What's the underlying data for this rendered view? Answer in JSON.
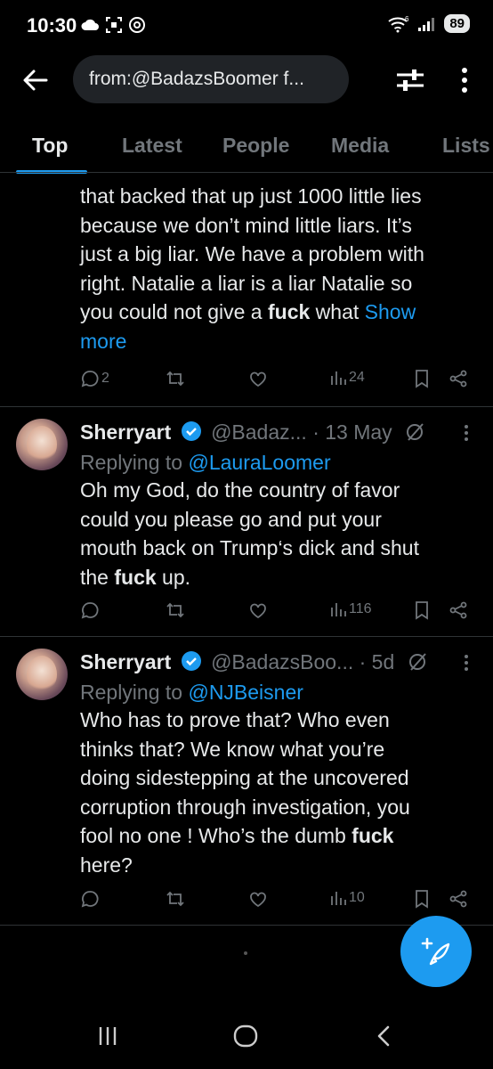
{
  "status": {
    "time": "10:30",
    "battery": "89",
    "network": "6"
  },
  "search": {
    "query": "from:@BadazsBoomer f..."
  },
  "tabs": [
    {
      "label": "Top"
    },
    {
      "label": "Latest"
    },
    {
      "label": "People"
    },
    {
      "label": "Media"
    },
    {
      "label": "Lists"
    }
  ],
  "tweets": [
    {
      "body_lines": [
        "that backed that up just 1000 little lies",
        "because we don’t mind little liars. It’s",
        "just a big liar. We have a problem with",
        "right. Natalie a liar is a liar Natalie so"
      ],
      "last_line_pre": "you could not give a ",
      "last_line_bold": "fuck",
      "last_line_post": " what ",
      "show_more_a": "Show",
      "show_more_b": "more",
      "replies": "2",
      "views": "24"
    },
    {
      "name": "Sherryart",
      "handle": "@Badaz...",
      "time": "· 13 May",
      "reply_prefix": "Replying to ",
      "reply_to": "@LauraLoomer",
      "body_lines": [
        "Oh my God, do the country of favor",
        "could you please go and put your",
        "mouth back on Trump‘s dick and shut"
      ],
      "last_pre": "the ",
      "last_bold": "fuck",
      "last_post": " up.",
      "views": "116"
    },
    {
      "name": "Sherryart",
      "handle": "@BadazsBoo...",
      "time": "· 5d",
      "reply_prefix": "Replying to ",
      "reply_to": "@NJBeisner",
      "body_lines": [
        "Who has to prove that? Who even",
        "thinks that? We know what you’re",
        "doing sidestepping at the uncovered",
        "corruption through investigation, you"
      ],
      "pre_bold": "fool no one !  Who’s the dumb ",
      "bold": "fuck",
      "last_line": "here?",
      "views": "10"
    }
  ],
  "colors": {
    "accent": "#1d9bf0",
    "muted": "#71767b",
    "text": "#e7e9ea",
    "background": "#000000"
  }
}
